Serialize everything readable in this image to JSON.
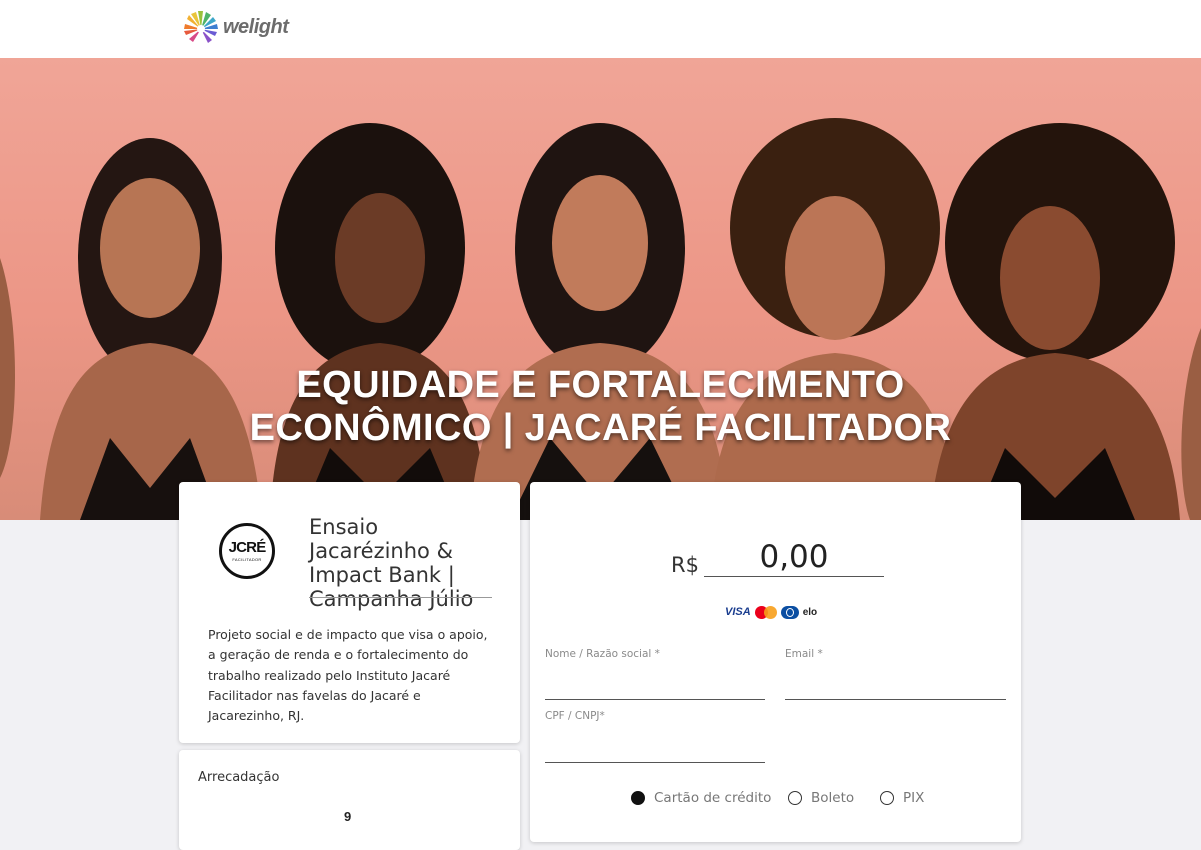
{
  "header": {
    "logo_text": "welight"
  },
  "hero": {
    "title_line1": "EQUIDADE E FORTALECIMENTO",
    "title_line2": "ECONÔMICO | JACARÉ FACILITADOR"
  },
  "campaign": {
    "logo_text": "JCRÉ",
    "logo_subtext": "FACILITADOR",
    "title": "Ensaio Jacarézinho & Impact Bank | Campanha Júlio",
    "description": "Projeto social e de impacto que visa o apoio, a geração de renda e o fortalecimento do trabalho realizado pelo Instituto Jacaré Facilitador nas favelas do Jacaré e Jacarezinho, RJ."
  },
  "raised": {
    "label": "Arrecadação",
    "value": "9"
  },
  "donation": {
    "currency": "R$",
    "amount": "0,00",
    "card_brands": [
      "VISA",
      "mastercard",
      "diners",
      "elo"
    ],
    "fields": {
      "name_label": "Nome / Razão social *",
      "email_label": "Email *",
      "cpf_label": "CPF / CNPJ*"
    },
    "payment_methods": {
      "credit_card": "Cartão de crédito",
      "boleto": "Boleto",
      "pix": "PIX",
      "selected": "credit_card"
    }
  },
  "colors": {
    "hero_background": "#ec9686",
    "page_background": "#f1f1f4",
    "card_background": "#ffffff"
  }
}
